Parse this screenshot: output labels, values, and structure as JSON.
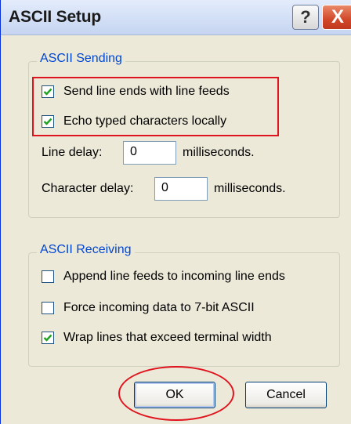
{
  "window": {
    "title": "ASCII Setup",
    "help_label": "?",
    "close_label": "X"
  },
  "ascii_sending": {
    "legend": "ASCII Sending",
    "options": [
      {
        "label": "Send line ends with line feeds",
        "checked": true
      },
      {
        "label": "Echo typed characters locally",
        "checked": true
      }
    ],
    "line_delay": {
      "label": "Line delay:",
      "value": "0",
      "unit": "milliseconds."
    },
    "character_delay": {
      "label": "Character delay:",
      "value": "0",
      "unit": "milliseconds."
    }
  },
  "ascii_receiving": {
    "legend": "ASCII Receiving",
    "options": [
      {
        "label": "Append line feeds to incoming line ends",
        "checked": false
      },
      {
        "label": "Force incoming data to 7-bit ASCII",
        "checked": false
      },
      {
        "label": "Wrap lines that exceed terminal width",
        "checked": true
      }
    ]
  },
  "buttons": {
    "ok_label": "OK",
    "cancel_label": "Cancel"
  },
  "colors": {
    "annotation_red": "#e0141e",
    "group_title_blue": "#0046d5",
    "check_green": "#21a121",
    "dialog_background": "#ece9d8"
  }
}
